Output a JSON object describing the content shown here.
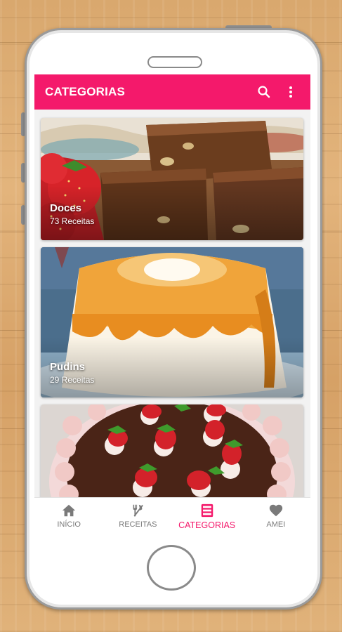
{
  "app_bar": {
    "title": "CATEGORIAS",
    "search_icon": "search-icon",
    "menu_icon": "more-vert-icon"
  },
  "categories": [
    {
      "title": "Doces",
      "count": "73 Receitas",
      "image": "brownies-with-strawberries"
    },
    {
      "title": "Pudins",
      "count": "29 Receitas",
      "image": "caramel-pudding"
    },
    {
      "title": "",
      "count": "",
      "image": "chocolate-strawberry-cake"
    }
  ],
  "bottom_nav": {
    "items": [
      {
        "label": "INÍCIO",
        "icon": "home-icon",
        "active": false
      },
      {
        "label": "RECEITAS",
        "icon": "fork-knife-icon",
        "active": false
      },
      {
        "label": "CATEGORIAS",
        "icon": "categories-icon",
        "active": true
      },
      {
        "label": "AMEI",
        "icon": "heart-icon",
        "active": false
      }
    ]
  },
  "colors": {
    "accent": "#f4196b",
    "nav_inactive": "#7a7a7a",
    "background": "#f2f2f2"
  }
}
